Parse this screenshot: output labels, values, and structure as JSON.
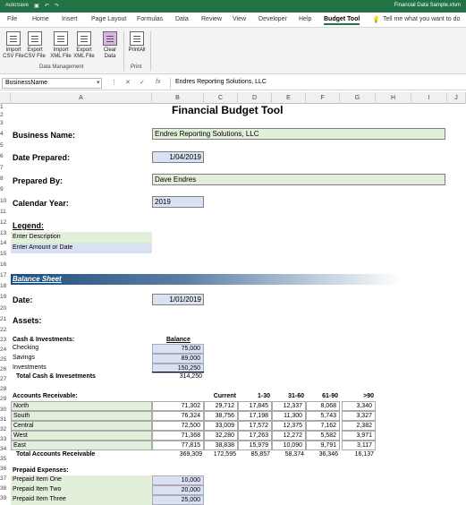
{
  "titlebar": {
    "autosave": "AutoSave",
    "file_name": "Financial Data Sample.xlsm"
  },
  "menu": {
    "tabs": [
      "File",
      "Home",
      "Insert",
      "Page Layout",
      "Formulas",
      "Data",
      "Review",
      "View",
      "Developer",
      "Help",
      "Budget Tool"
    ],
    "active": "Budget Tool",
    "tell_me": "Tell me what you want to do"
  },
  "ribbon": {
    "buttons": [
      {
        "line1": "Import",
        "line2": "CSV File",
        "icon": "csv-import-icon"
      },
      {
        "line1": "Export",
        "line2": "CSV File",
        "icon": "csv-export-icon"
      },
      {
        "line1": "Import",
        "line2": "XML File",
        "icon": "xml-import-icon"
      },
      {
        "line1": "Export",
        "line2": "XML File",
        "icon": "xml-export-icon"
      },
      {
        "line1": "Clear",
        "line2": "Data",
        "icon": "eraser-icon"
      },
      {
        "line1": "PrintAll",
        "line2": "",
        "icon": "printer-icon"
      }
    ],
    "groups": [
      "Data Management",
      "Print"
    ]
  },
  "formula_bar": {
    "name_box": "BusinessName",
    "content": "Endres Reporting Solutions, LLC"
  },
  "columns": [
    "A",
    "B",
    "C",
    "D",
    "E",
    "F",
    "G",
    "H",
    "I",
    "J"
  ],
  "rows": [
    "1",
    "2",
    "3",
    "4",
    "5",
    "6",
    "7",
    "8",
    "9",
    "10",
    "11",
    "12",
    "13",
    "14",
    "15",
    "16",
    "17",
    "18",
    "19",
    "20",
    "21",
    "22",
    "23",
    "24",
    "25",
    "26",
    "27",
    "28",
    "29",
    "30",
    "31",
    "32",
    "33",
    "34",
    "35",
    "36",
    "37",
    "38",
    "39"
  ],
  "sheet": {
    "title": "Financial Budget Tool",
    "business_name_label": "Business Name:",
    "business_name": "Endres Reporting Solutions, LLC",
    "date_prepared_label": "Date Prepared:",
    "date_prepared": "1/04/2019",
    "prepared_by_label": "Prepared By:",
    "prepared_by": "Dave Endres",
    "calendar_year_label": "Calendar Year:",
    "calendar_year": "2019",
    "legend_label": "Legend:",
    "legend_desc": "Enter Description",
    "legend_amount": "Enter Amount or Date",
    "balance_sheet": "Balance Sheet",
    "date_label": "Date:",
    "date": "1/01/2019",
    "assets_label": "Assets:",
    "cash_label": "Cash & Investments:",
    "balance_header": "Balance",
    "cash": [
      {
        "name": "Checking",
        "value": "75,000"
      },
      {
        "name": "Savings",
        "value": "89,000"
      },
      {
        "name": "Investments",
        "value": "150,250"
      }
    ],
    "cash_total_label": "Total Cash & Invesetments",
    "cash_total": "314,250",
    "ar_label": "Accounts Receivable:",
    "ar_headers": [
      "Current",
      "1-30",
      "31-60",
      "61-90",
      ">90"
    ],
    "ar_rows": [
      {
        "name": "North",
        "total": "71,302",
        "v": [
          "29,712",
          "17,845",
          "12,337",
          "8,068",
          "3,340"
        ]
      },
      {
        "name": "South",
        "total": "76,324",
        "v": [
          "38,756",
          "17,198",
          "11,300",
          "5,743",
          "3,327"
        ]
      },
      {
        "name": "Central",
        "total": "72,500",
        "v": [
          "33,009",
          "17,572",
          "12,375",
          "7,162",
          "2,382"
        ]
      },
      {
        "name": "West",
        "total": "71,368",
        "v": [
          "32,280",
          "17,263",
          "12,272",
          "5,582",
          "3,971"
        ]
      },
      {
        "name": "East",
        "total": "77,815",
        "v": [
          "38,838",
          "15,979",
          "10,090",
          "9,791",
          "3,117"
        ]
      }
    ],
    "ar_total_label": "Total Accounts Receivable",
    "ar_total": "369,309",
    "ar_total_v": [
      "172,595",
      "85,857",
      "58,374",
      "36,346",
      "16,137"
    ],
    "prepaid_label": "Prepaid Expenses:",
    "prepaid": [
      {
        "name": "Prepaid Item One",
        "value": "10,000"
      },
      {
        "name": "Prepaid Item Two",
        "value": "20,000"
      },
      {
        "name": "Prepaid Item Three",
        "value": "25,000"
      }
    ]
  }
}
